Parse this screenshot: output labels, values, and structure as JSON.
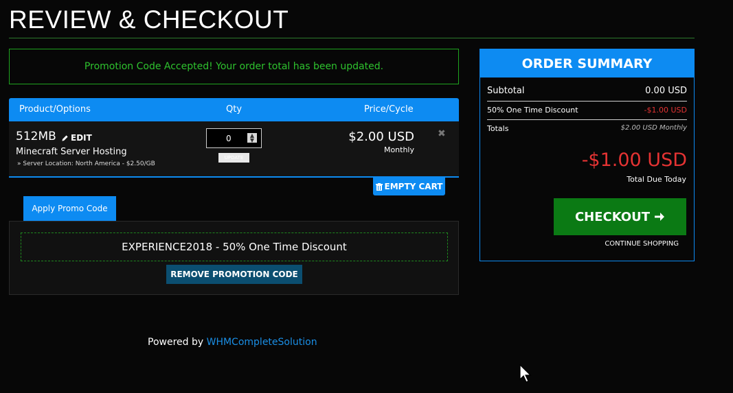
{
  "page": {
    "title": "REVIEW & CHECKOUT"
  },
  "alert": {
    "message": "Promotion Code Accepted! Your order total has been updated."
  },
  "cart": {
    "headers": {
      "product": "Product/Options",
      "qty": "Qty",
      "price": "Price/Cycle"
    },
    "item": {
      "name": "512MB",
      "edit_label": "EDIT",
      "group": "Minecraft Server Hosting",
      "config": "» Server Location: North America - $2.50/GB",
      "qty": "0",
      "update_label": "UPDATE",
      "price": "$2.00 USD",
      "cycle": "Monthly",
      "remove_glyph": "✖"
    },
    "empty_cart_label": "EMPTY CART"
  },
  "promo": {
    "tab_label": "Apply Promo Code",
    "applied_text": "EXPERIENCE2018 - 50% One Time Discount",
    "remove_label": "REMOVE PROMOTION CODE"
  },
  "footer": {
    "powered_prefix": "Powered by",
    "powered_link": "WHMCompleteSolution"
  },
  "summary": {
    "title": "ORDER SUMMARY",
    "subtotal_label": "Subtotal",
    "subtotal_value": "0.00 USD",
    "discount_label": "50% One Time Discount",
    "discount_value": "-$1.00 USD",
    "totals_label": "Totals",
    "totals_value": "$2.00 USD Monthly",
    "total_due": "-$1.00 USD",
    "total_due_label": "Total Due Today",
    "checkout_label": "CHECKOUT",
    "continue_label": "CONTINUE SHOPPING"
  },
  "colors": {
    "accent_blue": "#0d8bf2",
    "success_green": "#2ec22e",
    "checkout_green": "#0b7a14",
    "negative_red": "#e53333",
    "background": "#070707"
  },
  "icons": [
    "pencil-icon",
    "spinner-arrows-icon",
    "remove-x-icon",
    "trash-icon",
    "arrow-right-icon",
    "mouse-cursor-icon"
  ]
}
